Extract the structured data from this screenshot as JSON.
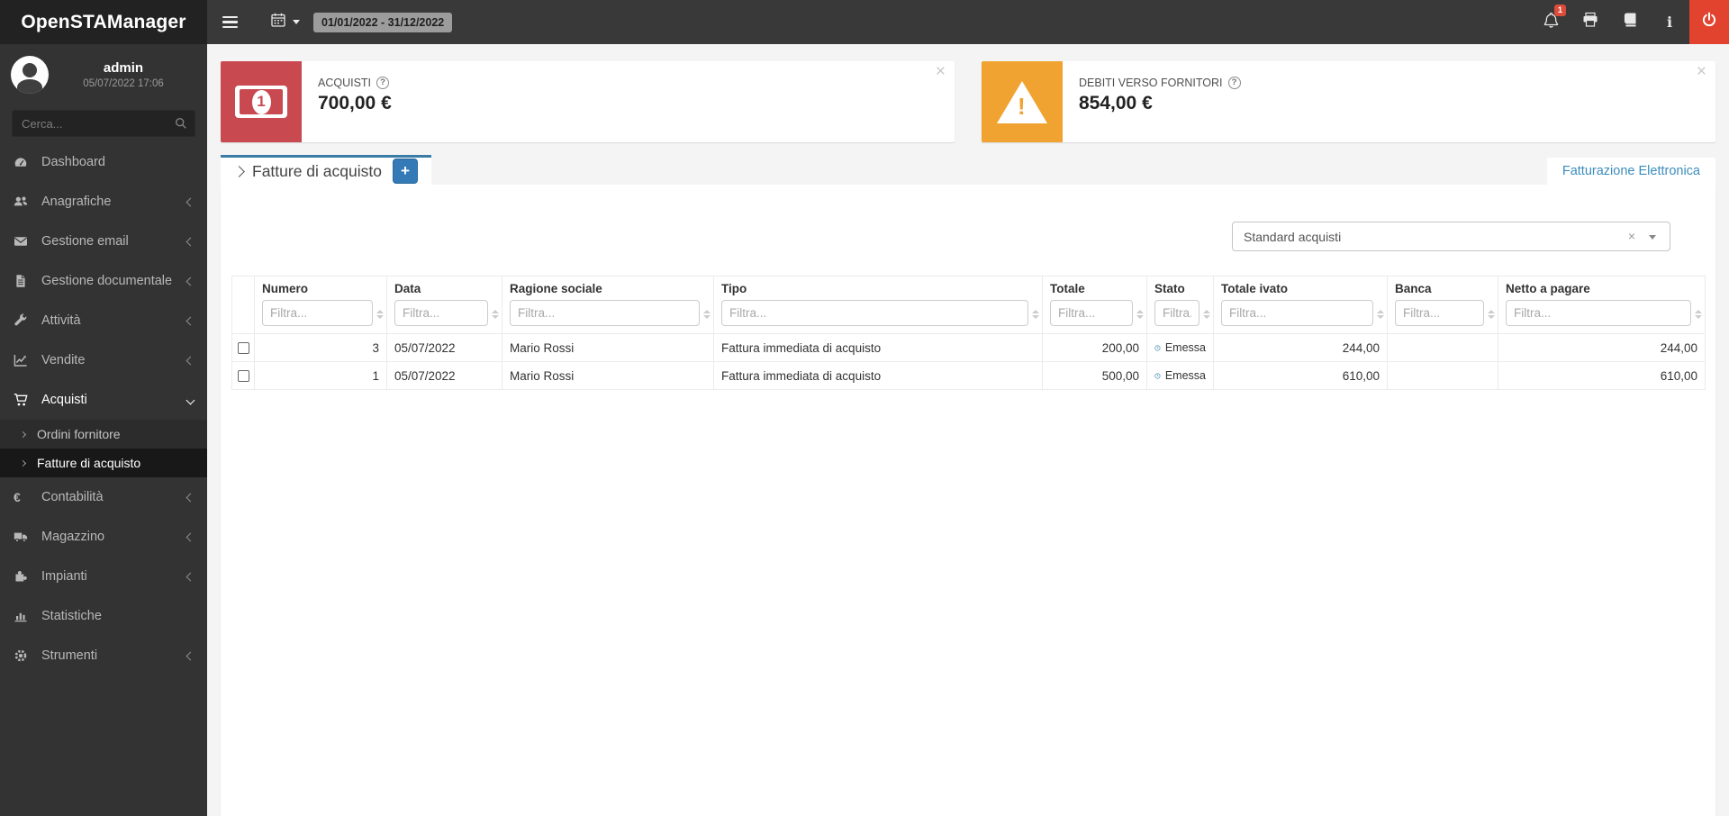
{
  "app": {
    "title": "OpenSTAManager"
  },
  "topbar": {
    "date_range": "01/01/2022 - 31/12/2022",
    "notification_count": "1"
  },
  "user": {
    "name": "admin",
    "datetime": "05/07/2022 17:06"
  },
  "search": {
    "placeholder": "Cerca..."
  },
  "sidebar": {
    "items": [
      {
        "label": "Dashboard"
      },
      {
        "label": "Anagrafiche"
      },
      {
        "label": "Gestione email"
      },
      {
        "label": "Gestione documentale"
      },
      {
        "label": "Attività"
      },
      {
        "label": "Vendite"
      },
      {
        "label": "Acquisti"
      },
      {
        "label": "Contabilità"
      },
      {
        "label": "Magazzino"
      },
      {
        "label": "Impianti"
      },
      {
        "label": "Statistiche"
      },
      {
        "label": "Strumenti"
      }
    ],
    "acquisti_children": [
      {
        "label": "Ordini fornitore"
      },
      {
        "label": "Fatture di acquisto",
        "active": true
      }
    ]
  },
  "info_boxes": [
    {
      "label": "ACQUISTI",
      "value": "700,00 €"
    },
    {
      "label": "DEBITI VERSO FORNITORI",
      "value": "854,00 €"
    }
  ],
  "tabs": {
    "active_title": "Fatture di acquisto",
    "add_button_label": "+",
    "right_link": "Fatturazione Elettronica"
  },
  "filter_select": {
    "value": "Standard acquisti"
  },
  "table": {
    "filter_placeholder": "Filtra...",
    "columns": [
      {
        "label": "Numero"
      },
      {
        "label": "Data"
      },
      {
        "label": "Ragione sociale"
      },
      {
        "label": "Tipo"
      },
      {
        "label": "Totale"
      },
      {
        "label": "Stato"
      },
      {
        "label": "Totale ivato"
      },
      {
        "label": "Banca"
      },
      {
        "label": "Netto a pagare"
      }
    ],
    "rows": [
      {
        "numero": "3",
        "data": "05/07/2022",
        "ragione_sociale": "Mario Rossi",
        "tipo": "Fattura immediata di acquisto",
        "totale": "200,00",
        "stato": "Emessa",
        "totale_ivato": "244,00",
        "banca": "",
        "netto_a_pagare": "244,00"
      },
      {
        "numero": "1",
        "data": "05/07/2022",
        "ragione_sociale": "Mario Rossi",
        "tipo": "Fattura immediata di acquisto",
        "totale": "500,00",
        "stato": "Emessa",
        "totale_ivato": "610,00",
        "banca": "",
        "netto_a_pagare": "610,00"
      }
    ]
  },
  "icons": {
    "hamburger": "☰",
    "calendar": "▦",
    "bell": "🔔",
    "printer": "⎙",
    "manual-book": "📖",
    "info": "i",
    "power": "⏻",
    "search": "🔍",
    "help": "?",
    "close": "×",
    "clear": "×",
    "caret-down": "▾",
    "chevron-left": "‹",
    "chevron-down": "⌄",
    "chevron-right": "›",
    "status-clock": "🕓",
    "checkbox": "☐"
  },
  "colors": {
    "accent_blue": "#3a7ca5",
    "link_blue": "#3c8dbc",
    "button_blue": "#337ab7",
    "box_red": "#c84a50",
    "box_yellow": "#f0a330",
    "power_red": "#e2432f",
    "badge_red": "#dd4b39",
    "status_blue": "#3a87ad",
    "sidebar_bg": "#333333",
    "logo_bg": "#222222",
    "topbar_bg": "#393939",
    "page_bg": "#f4f4f4"
  }
}
